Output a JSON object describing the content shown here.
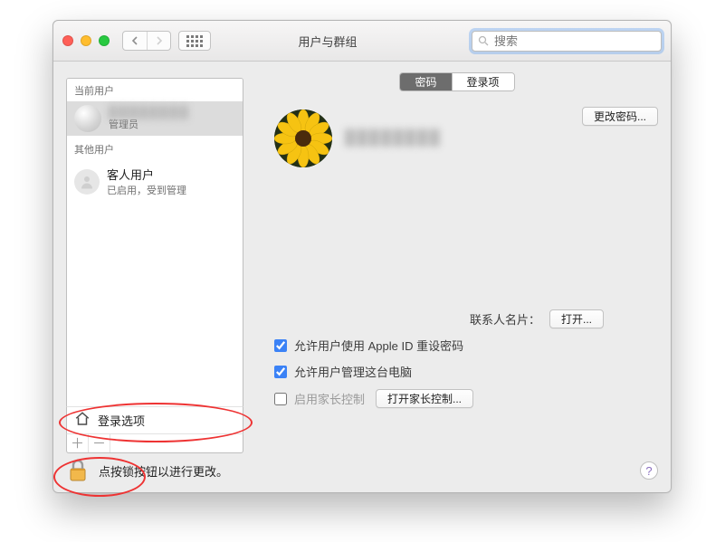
{
  "titlebar": {
    "title": "用户与群组",
    "search_placeholder": "搜索"
  },
  "sidebar": {
    "current_header": "当前用户",
    "current_user": {
      "name": "████████",
      "role": "管理员"
    },
    "other_header": "其他用户",
    "guest": {
      "name": "客人用户",
      "status": "已启用，受到管理"
    },
    "login_options": "登录选项"
  },
  "main": {
    "tabs": [
      "密码",
      "登录项"
    ],
    "full_name": "████████",
    "change_password": "更改密码...",
    "contacts_label": "联系人名片：",
    "open_btn": "打开...",
    "options": [
      {
        "label": "允许用户使用 Apple ID 重设密码",
        "checked": true
      },
      {
        "label": "允许用户管理这台电脑",
        "checked": true
      },
      {
        "label": "启用家长控制",
        "checked": false,
        "button": "打开家长控制..."
      }
    ]
  },
  "footer": {
    "lock_hint": "点按锁按钮以进行更改。"
  },
  "colors": {
    "accent": "#6d6d6d",
    "annotation": "#e33"
  }
}
